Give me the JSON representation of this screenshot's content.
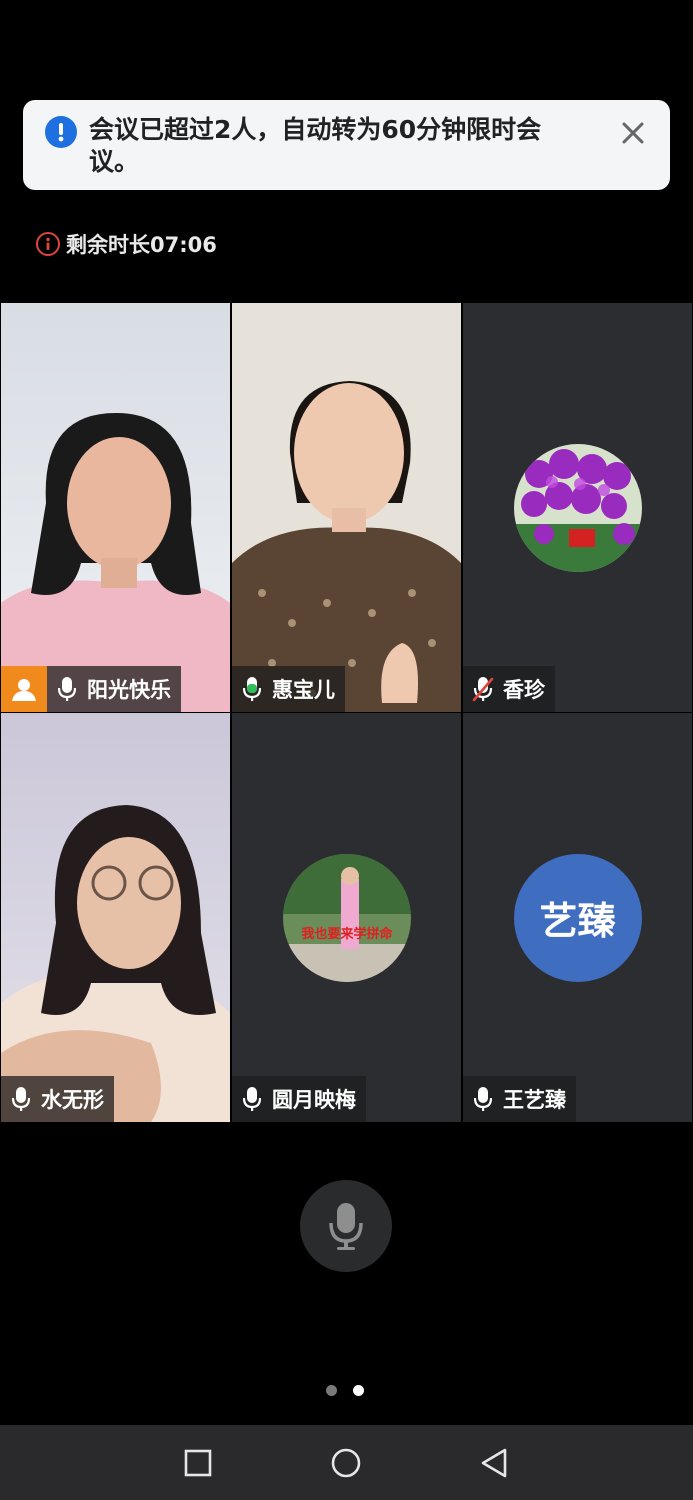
{
  "toast": {
    "message": "会议已超过2人，自动转为60分钟限时会议。",
    "icon": "alert-icon",
    "close_icon": "close-icon",
    "accent": "#1e6fe0"
  },
  "timer": {
    "label": "剩余时长07:06",
    "icon": "info-icon",
    "color": "#e0453b"
  },
  "participants": [
    {
      "name": "阳光快乐",
      "host": true,
      "mic": "on",
      "video": true,
      "active": false
    },
    {
      "name": "惠宝儿",
      "host": false,
      "mic": "speaking",
      "video": true,
      "active": true
    },
    {
      "name": "香珍",
      "host": false,
      "mic": "muted",
      "video": false,
      "avatar": "orchid-photo"
    },
    {
      "name": "水无形",
      "host": false,
      "mic": "on",
      "video": true,
      "active": false
    },
    {
      "name": "圆月映梅",
      "host": false,
      "mic": "on",
      "video": false,
      "avatar": "photo",
      "avatar_caption": "我也要来学拼命"
    },
    {
      "name": "王艺臻",
      "host": false,
      "mic": "on",
      "video": false,
      "avatar_text": "艺臻",
      "avatar_color": "#3f6dbf"
    }
  ],
  "controls": {
    "mic_icon": "microphone-icon"
  },
  "pager": {
    "pages": 2,
    "current": 2
  },
  "navbar": {
    "items": [
      "recent-apps-icon",
      "home-icon",
      "back-icon"
    ]
  }
}
